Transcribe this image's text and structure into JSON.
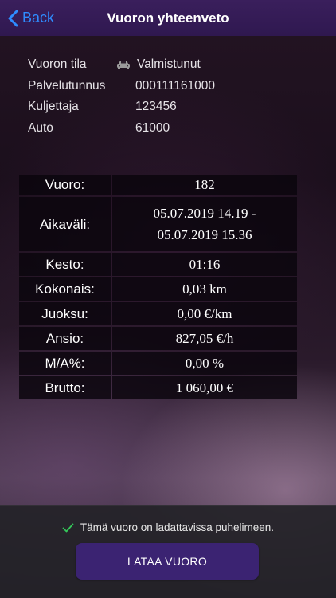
{
  "navbar": {
    "back_label": "Back",
    "title": "Vuoron yhteenveto"
  },
  "info": {
    "rows": [
      {
        "label": "Vuoron tila",
        "value": "Valmistunut",
        "icon": "car-icon"
      },
      {
        "label": "Palvelutunnus",
        "value": "000111161000"
      },
      {
        "label": "Kuljettaja",
        "value": "123456"
      },
      {
        "label": "Auto",
        "value": "61000"
      }
    ]
  },
  "stats": {
    "shift_label": "Vuoro:",
    "shift_value": "182",
    "interval_label": "Aikaväli:",
    "interval_line1": "05.07.2019 14.19 -",
    "interval_line2": "05.07.2019 15.36",
    "rows": [
      {
        "label": "Kesto:",
        "value": "01:16"
      },
      {
        "label": "Kokonais:",
        "value": "0,03 km"
      },
      {
        "label": "Juoksu:",
        "value": "0,00 €/km"
      },
      {
        "label": "Ansio:",
        "value": "827,05 €/h"
      },
      {
        "label": "M/A%:",
        "value": "0,00 %"
      },
      {
        "label": "Brutto:",
        "value": "1 060,00 €"
      }
    ]
  },
  "footer": {
    "notice": "Tämä vuoro on ladattavissa puhelimeen.",
    "button_label": "LATAA VUORO"
  },
  "colors": {
    "accent_blue": "#2f8cff",
    "navbar_purple": "#3a1f5c",
    "button_purple": "#3b2372",
    "check_green": "#34c759"
  }
}
